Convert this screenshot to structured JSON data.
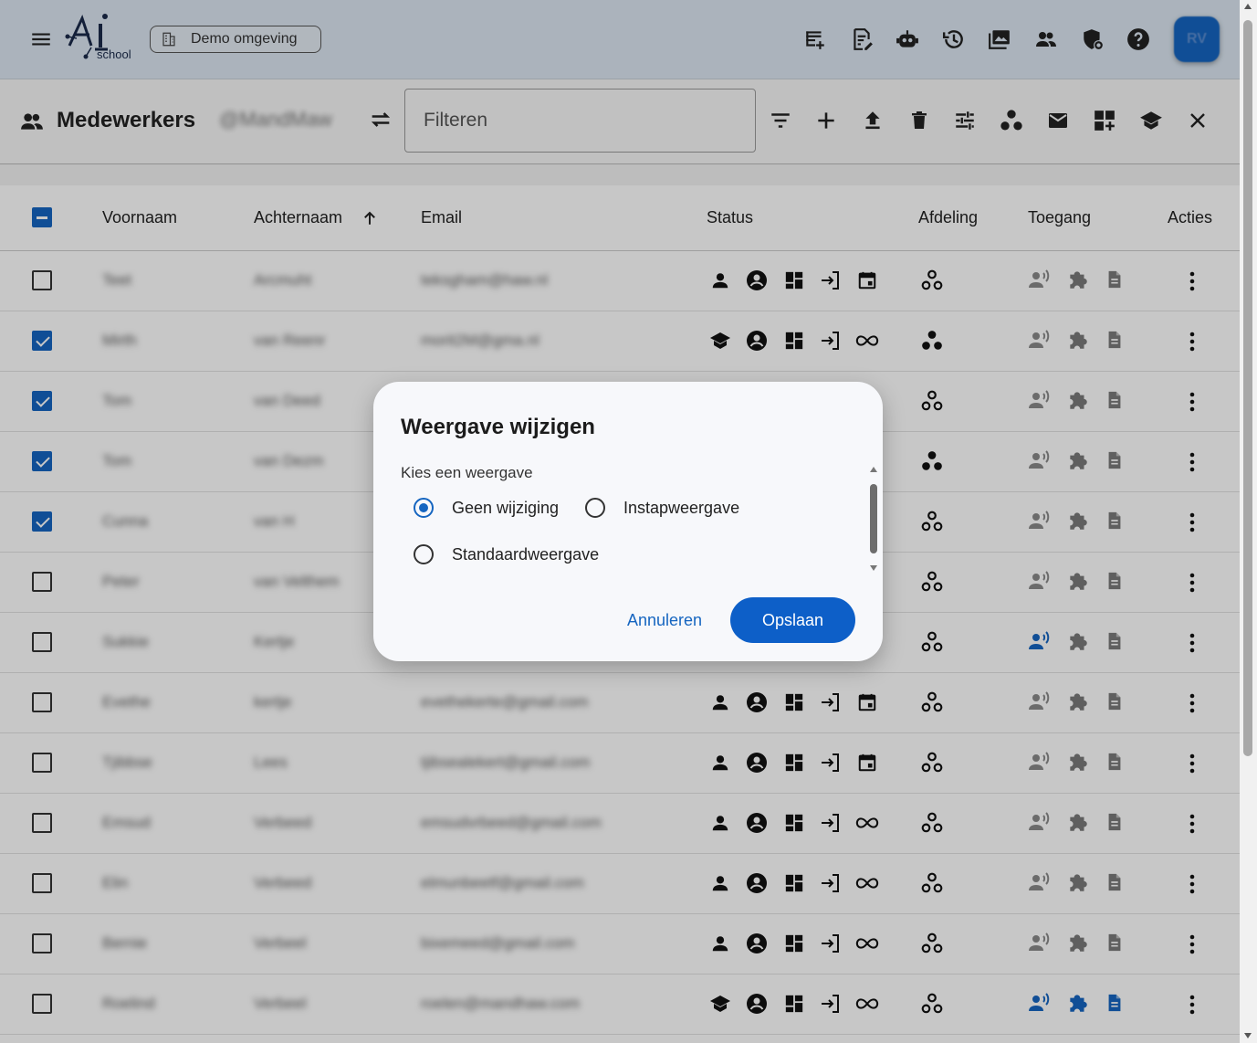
{
  "topbar": {
    "menu_icon": "menu-icon",
    "logo_text": "school",
    "environment_label": "Demo omgeving",
    "icons": [
      "notes-add-icon",
      "doc-edit-icon",
      "robot-icon",
      "history-icon",
      "photo-library-icon",
      "people-icon",
      "shield-settings-icon",
      "help-icon"
    ],
    "avatar_initials": "RV",
    "colors": {
      "bar": "#dbe6f1",
      "accent": "#1565c0"
    }
  },
  "subbar": {
    "title": "Medewerkers",
    "school_tag": "@MandMaw",
    "filter_placeholder": "Filteren",
    "icons": [
      "filter-list-icon",
      "add-icon",
      "upload-icon",
      "delete-icon",
      "tune-icon",
      "group-work-icon",
      "mail-icon",
      "dashboard-add-icon",
      "school-icon",
      "close-icon"
    ]
  },
  "table": {
    "headers": {
      "first_name": "Voornaam",
      "last_name": "Achternaam",
      "email": "Email",
      "status": "Status",
      "department": "Afdeling",
      "access": "Toegang",
      "actions": "Acties"
    },
    "rows": [
      {
        "first": "Teet",
        "last": "Arcmuht",
        "email": "teksgham@haw.nl",
        "checked": false
      },
      {
        "first": "Mirth",
        "last": "van Reenr",
        "email": "morit2M@gma.nl",
        "checked": true
      },
      {
        "first": "Tom",
        "last": "van Deed",
        "email": "",
        "checked": true
      },
      {
        "first": "Tom",
        "last": "van Dezm",
        "email": "",
        "checked": true
      },
      {
        "first": "Cunna",
        "last": "van H",
        "email": "",
        "checked": true
      },
      {
        "first": "Peter",
        "last": "van Velthem",
        "email": "",
        "checked": false
      },
      {
        "first": "Sukkie",
        "last": "Kertje",
        "email": "",
        "checked": false
      },
      {
        "first": "Evethe",
        "last": "kertje",
        "email": "evethekerte@gmail.com",
        "checked": false
      },
      {
        "first": "Tjibbse",
        "last": "Lees",
        "email": "tjibsealekert@gmail.com",
        "checked": false
      },
      {
        "first": "Emsud",
        "last": "Verbeed",
        "email": "emsudvrbeed@gmail.com",
        "checked": false
      },
      {
        "first": "Elin",
        "last": "Verbeed",
        "email": "elmunbeetf@gmail.com",
        "checked": false
      },
      {
        "first": "Bernie",
        "last": "Verbeel",
        "email": "bixemeed@gmail.com",
        "checked": false
      },
      {
        "first": "Roelind",
        "last": "Verbeel",
        "email": "roelen@mandhaw.com",
        "checked": false
      }
    ]
  },
  "dialog": {
    "title": "Weergave wijzigen",
    "subtitle": "Kies een weergave",
    "options": [
      {
        "label": "Geen wijziging",
        "selected": true
      },
      {
        "label": "Instapweergave",
        "selected": false
      },
      {
        "label": "Standaardweergave",
        "selected": false
      }
    ],
    "cancel_label": "Annuleren",
    "save_label": "Opslaan"
  }
}
